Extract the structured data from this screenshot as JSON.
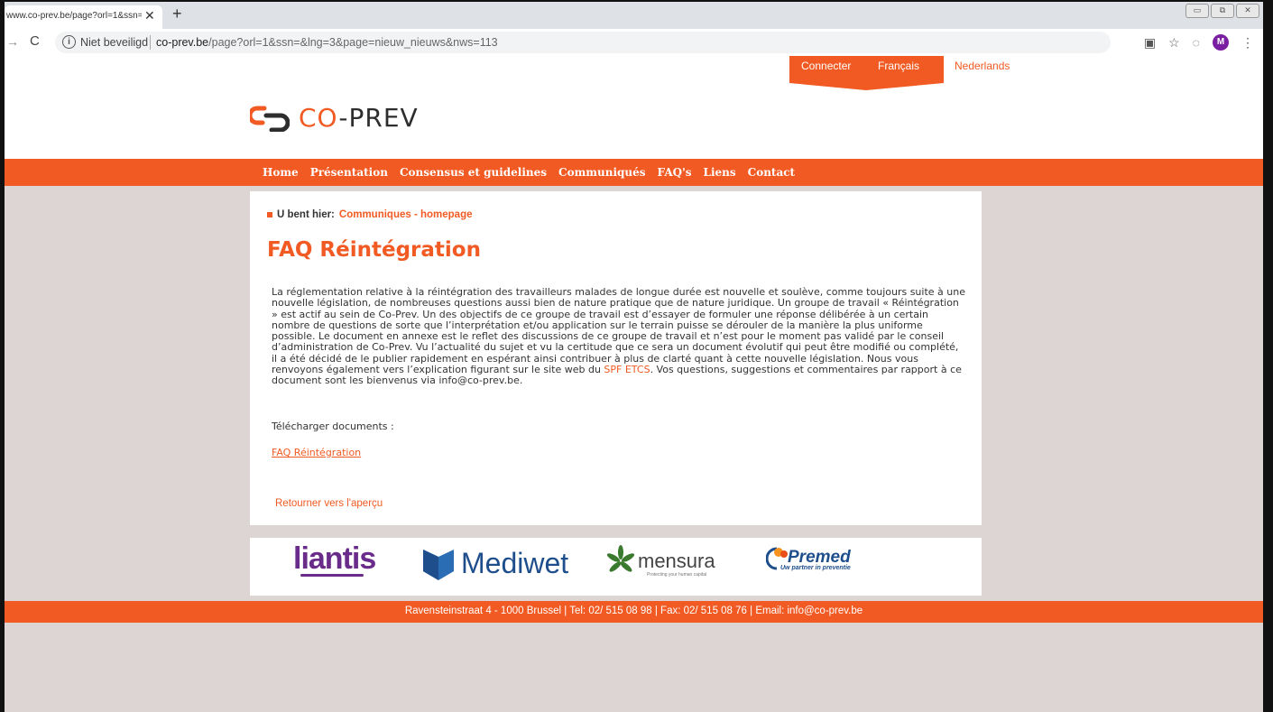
{
  "browser": {
    "tab_title": "www.co-prev.be/page?orl=1&ssn=",
    "security_label": "Niet beveiligd",
    "url_domain": "co-prev.be",
    "url_path": "/page?orl=1&ssn=&lng=3&page=nieuw_nieuws&nws=113",
    "avatar_letter": "M"
  },
  "header": {
    "connect": "Connecter",
    "lang_fr": "Français",
    "lang_nl": "Nederlands",
    "logo_prefix": "CO",
    "logo_suffix": "-PREV"
  },
  "nav": [
    "Home",
    "Présentation",
    "Consensus et guidelines",
    "Communiqués",
    "FAQ's",
    "Liens",
    "Contact"
  ],
  "breadcrumb": {
    "label": "U bent hier:",
    "link": "Communiques - homepage"
  },
  "main": {
    "title": "FAQ Réintégration",
    "paragraph_before_link": "La réglementation relative à la réintégration des travailleurs malades de longue durée est nouvelle et soulève, comme toujours suite à une nouvelle législation, de nombreuses questions aussi bien de nature pratique que de nature juridique. Un groupe de travail « Réintégration » est actif au sein de Co-Prev. Un des objectifs de ce groupe de travail est d’essayer de formuler une réponse délibérée à un certain nombre de questions de sorte que l’interprétation et/ou application sur le terrain puisse se dérouler de la manière la plus uniforme possible. Le document en annexe est le reflet des discussions de ce groupe de travail et n’est pour le moment pas validé par le conseil d’administration de Co-Prev. Vu l’actualité du sujet et vu la certitude que ce sera un document évolutif qui peut être modifié ou complété, il a été décidé de le publier rapidement en espérant ainsi contribuer à plus de clarté quant à cette nouvelle législation. Nous vous renvoyons également vers l’explication figurant sur le site web du ",
    "paragraph_link": "SPF ETCS",
    "paragraph_after_link": ". Vos questions, suggestions et commentaires par rapport à ce document sont les bienvenus via info@co-prev.be.",
    "download_label": "Télécharger documents :",
    "download_link": "FAQ Réintégration",
    "back_link": "Retourner vers l'aperçu"
  },
  "partners": {
    "liantis": "liantis",
    "mediwet": "Mediwet",
    "mensura": "mensura",
    "mensura_tagline": "Protecting your human capital",
    "premed": "Premed",
    "premed_tagline": "Uw partner in preventie"
  },
  "footer": {
    "text": "Ravensteinstraat 4 - 1000 Brussel | Tel: 02/ 515 08 98 | Fax: 02/ 515 08 76 | Email: info@co-prev.be"
  },
  "colors": {
    "accent": "#f15a22",
    "page_bg": "#ddd4d4",
    "logo_dark": "#2d2d2d"
  }
}
